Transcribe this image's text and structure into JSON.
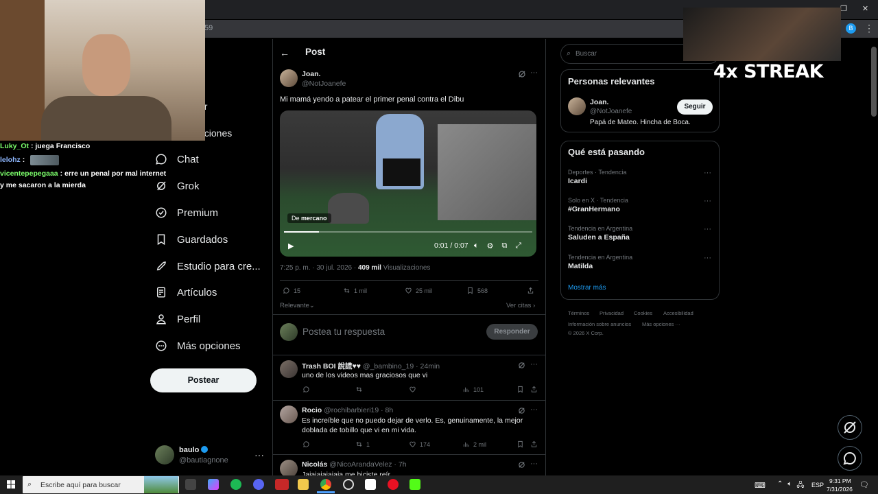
{
  "browser": {
    "address_fragment": "59",
    "profile_letter": "B"
  },
  "sidebar": {
    "partial_items": [
      "ar",
      "aciones"
    ],
    "items": [
      {
        "label": "Chat",
        "icon": "chat-icon"
      },
      {
        "label": "Grok",
        "icon": "grok-icon"
      },
      {
        "label": "Premium",
        "icon": "premium-icon"
      },
      {
        "label": "Guardados",
        "icon": "bookmark-icon"
      },
      {
        "label": "Estudio para cre...",
        "icon": "rocket-icon"
      },
      {
        "label": "Artículos",
        "icon": "article-icon"
      },
      {
        "label": "Perfil",
        "icon": "person-icon"
      },
      {
        "label": "Más opciones",
        "icon": "more-circle-icon"
      }
    ],
    "post_button": "Postear",
    "account": {
      "name": "baulo",
      "handle": "@bautiagnone"
    }
  },
  "header": {
    "title": "Post"
  },
  "post": {
    "author_name": "Joan.",
    "author_handle": "@NotJoanefe",
    "text": "Mi mamá yendo a patear el primer penal contra el Dibu",
    "video": {
      "source_label": "De",
      "source_name": "mercano",
      "time": "0:01 / 0:07",
      "progress": 0.14
    },
    "timestamp": "7:25 p. m. · 30 jul. 2026 ·",
    "views_count": "409 mil",
    "views_label": "Visualizaciones",
    "stats": {
      "replies": "15",
      "reposts": "1 mil",
      "likes": "25 mil",
      "bookmarks": "568"
    },
    "sort_label": "Relevante",
    "quotes_label": "Ver citas"
  },
  "compose": {
    "placeholder": "Postea tu respuesta",
    "button": "Responder"
  },
  "replies": [
    {
      "name": "Trash BOI 說謊♥♥",
      "handle": "@_bambino_19",
      "time": "· 24min",
      "text": "uno de los videos mas graciosos que vi",
      "retweets": "",
      "likes": "",
      "views": "101"
    },
    {
      "name": "Rocio",
      "handle": "@rochibarbieri19",
      "time": "· 8h",
      "text": "Es increíble que no puedo dejar de verlo. Es, genuinamente, la mejor doblada de tobillo que vi en mi vida.",
      "retweets": "1",
      "likes": "174",
      "views": "2 mil"
    },
    {
      "name": "Nicolás",
      "handle": "@NicoArandaVelez",
      "time": "· 7h",
      "text": "Jajajajajajaja me hiciste reír",
      "retweets": "",
      "likes": "",
      "views": ""
    }
  ],
  "right": {
    "search_placeholder": "Buscar",
    "relevant_title": "Personas relevantes",
    "relevant": {
      "name": "Joan.",
      "handle": "@NotJoanefe",
      "bio": "Papá de Mateo. Hincha de Boca.",
      "button": "Seguir"
    },
    "trends_title": "Qué está pasando",
    "trends": [
      {
        "meta": "Deportes · Tendencia",
        "name": "Icardi"
      },
      {
        "meta": "Solo en X · Tendencia",
        "name": "#GranHermano"
      },
      {
        "meta": "Tendencia en Argentina",
        "name": "Saluden a España"
      },
      {
        "meta": "Tendencia en Argentina",
        "name": "Matilda"
      }
    ],
    "show_more": "Mostrar más",
    "footer_line1": [
      "Términos",
      "Privacidad",
      "Cookies",
      "Accesibilidad"
    ],
    "footer_line2": [
      "Información sobre anuncios",
      "Más opciones ···"
    ],
    "footer_copy": "© 2026 X Corp."
  },
  "overlay": {
    "streak": "4x STREAK",
    "chat": [
      {
        "user": "Luky_Ot",
        "msg": ": juega Francisco",
        "color": "#7cff6b"
      },
      {
        "user": "lelohz",
        "msg": ":",
        "color": "#8fb8ff"
      },
      {
        "user": "vicentepepegaaa",
        "msg": ": erre un penal por mal internet",
        "color": "#7cff6b"
      },
      {
        "user": "",
        "msg": "y me sacaron a la mierda",
        "color": "#ffffff"
      }
    ]
  },
  "taskbar": {
    "search_placeholder": "Escribe aquí para buscar",
    "language": "ESP",
    "time": "9:31 PM",
    "date": "7/31/2026"
  },
  "colors": {
    "accent": "#1d9bf0",
    "background": "#000000",
    "border": "#2f3336",
    "muted": "#71767b"
  }
}
